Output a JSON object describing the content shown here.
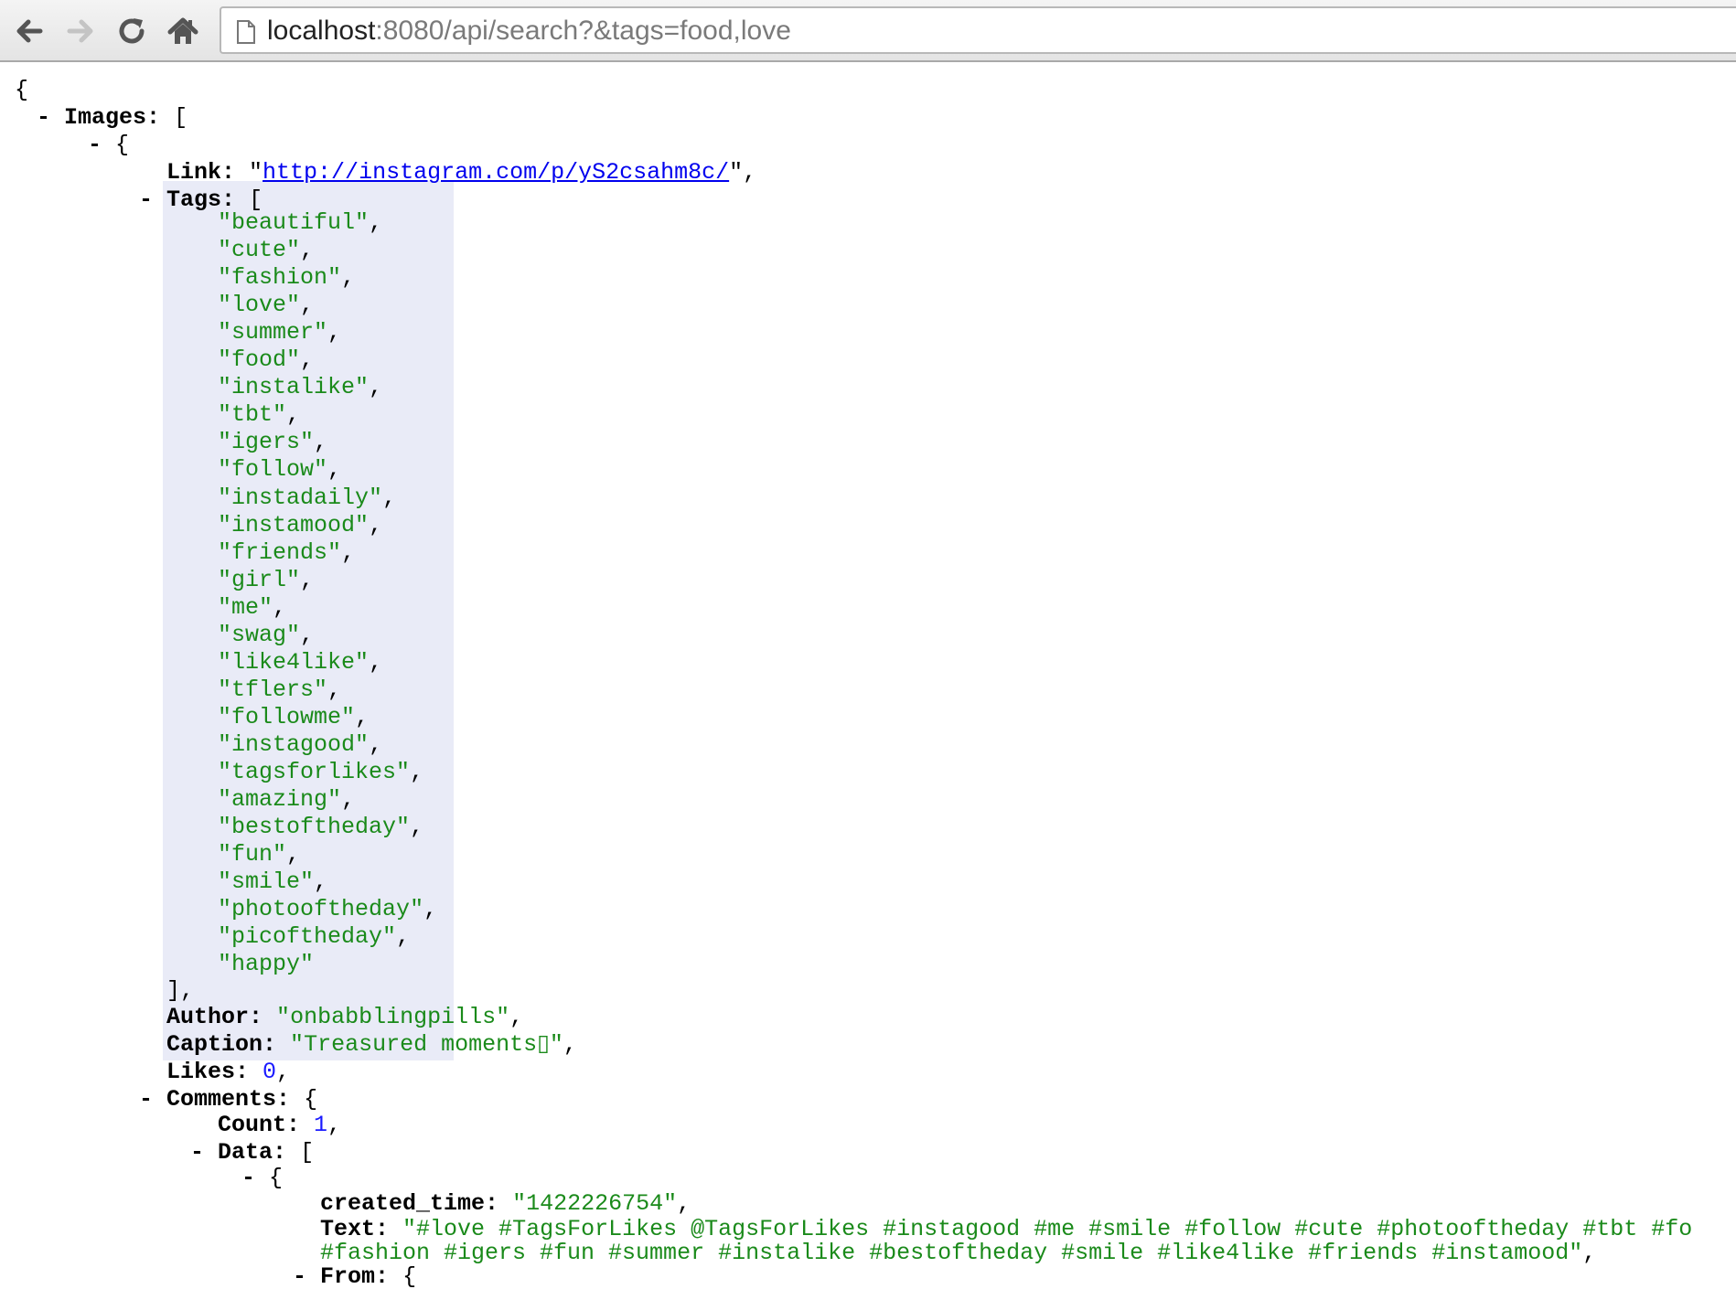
{
  "browser": {
    "url_host": "localhost",
    "url_rest": ":8080/api/search?&tags=food,love"
  },
  "json": {
    "open_brace": "{",
    "images_key": "Images:",
    "open_bracket": "[",
    "item_open": "{",
    "link_key": "Link:",
    "link_value": "http://instagram.com/p/yS2csahm8c/",
    "tags_key": "Tags:",
    "tags": [
      "beautiful",
      "cute",
      "fashion",
      "love",
      "summer",
      "food",
      "instalike",
      "tbt",
      "igers",
      "follow",
      "instadaily",
      "instamood",
      "friends",
      "girl",
      "me",
      "swag",
      "like4like",
      "tflers",
      "followme",
      "instagood",
      "tagsforlikes",
      "amazing",
      "bestoftheday",
      "fun",
      "smile",
      "photooftheday",
      "picoftheday",
      "happy"
    ],
    "tags_close": "],",
    "author_key": "Author:",
    "author_value": "onbabblingpills",
    "caption_key": "Caption:",
    "caption_value": "Treasured moments▯",
    "likes_key": "Likes:",
    "likes_value": "0",
    "comments_key": "Comments:",
    "count_key": "Count:",
    "count_value": "1",
    "data_key": "Data:",
    "created_time_key": "created_time:",
    "created_time_value": "1422226754",
    "text_key": "Text:",
    "text_value_line1": "#love #TagsForLikes @TagsForLikes #instagood #me #smile #follow #cute #photooftheday #tbt #fo",
    "text_value_line2": "#fashion #igers #fun #summer #instalike #bestoftheday #smile #like4like #friends #instamood",
    "from_key": "From:",
    "collapse_toggle": "-"
  },
  "icons": [
    "back-arrow-icon",
    "forward-arrow-icon",
    "reload-icon",
    "home-icon",
    "page-icon"
  ]
}
